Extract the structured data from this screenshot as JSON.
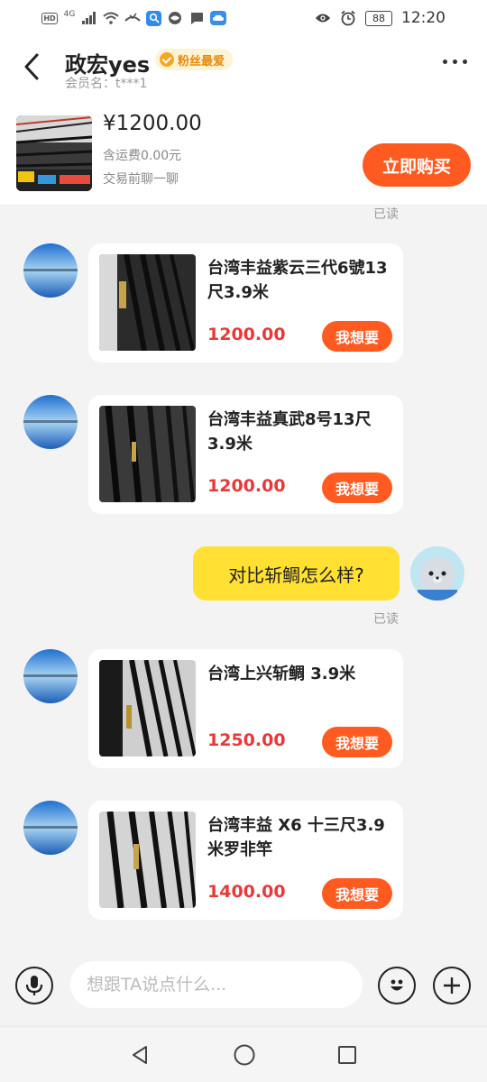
{
  "status_bar": {
    "hd": "HD",
    "network": "4G",
    "battery": "88",
    "time": "12:20"
  },
  "header": {
    "seller_name": "政宏yes",
    "badge": "粉丝最爱",
    "member_label": "会员名：",
    "member_id": "t***1"
  },
  "product": {
    "price": "¥1200.00",
    "shipping": "含运费0.00元",
    "chat_hint": "交易前聊一聊",
    "buy_label": "立即购买"
  },
  "read_label": "已读",
  "messages": [
    {
      "title": "台湾丰益紫云三代6號13尺3.9米",
      "price": "1200.00",
      "button": "我想要"
    },
    {
      "title": "台湾丰益真武8号13尺3.9米",
      "price": "1200.00",
      "button": "我想要"
    },
    {
      "title": "台湾上兴斩鲷 3.9米",
      "price": "1250.00",
      "button": "我想要"
    },
    {
      "title": "台湾丰益 X6 十三尺3.9米罗非竿",
      "price": "1400.00",
      "button": "我想要"
    }
  ],
  "my_message": "对比斩鲷怎么样?",
  "input": {
    "placeholder": "想跟TA说点什么..."
  },
  "icons": {
    "back": "chevron-left-icon",
    "more": "more-horizontal-icon",
    "voice": "microphone-icon",
    "emoji": "smile-icon",
    "add": "plus-icon",
    "nav_back": "triangle-back-icon",
    "nav_home": "circle-home-icon",
    "nav_recent": "square-recent-icon"
  },
  "colors": {
    "accent": "#ff5a1f",
    "price_red": "#e8383a",
    "my_bubble": "#ffe033",
    "badge_bg": "#fff3d6",
    "badge_text": "#e8890c"
  }
}
